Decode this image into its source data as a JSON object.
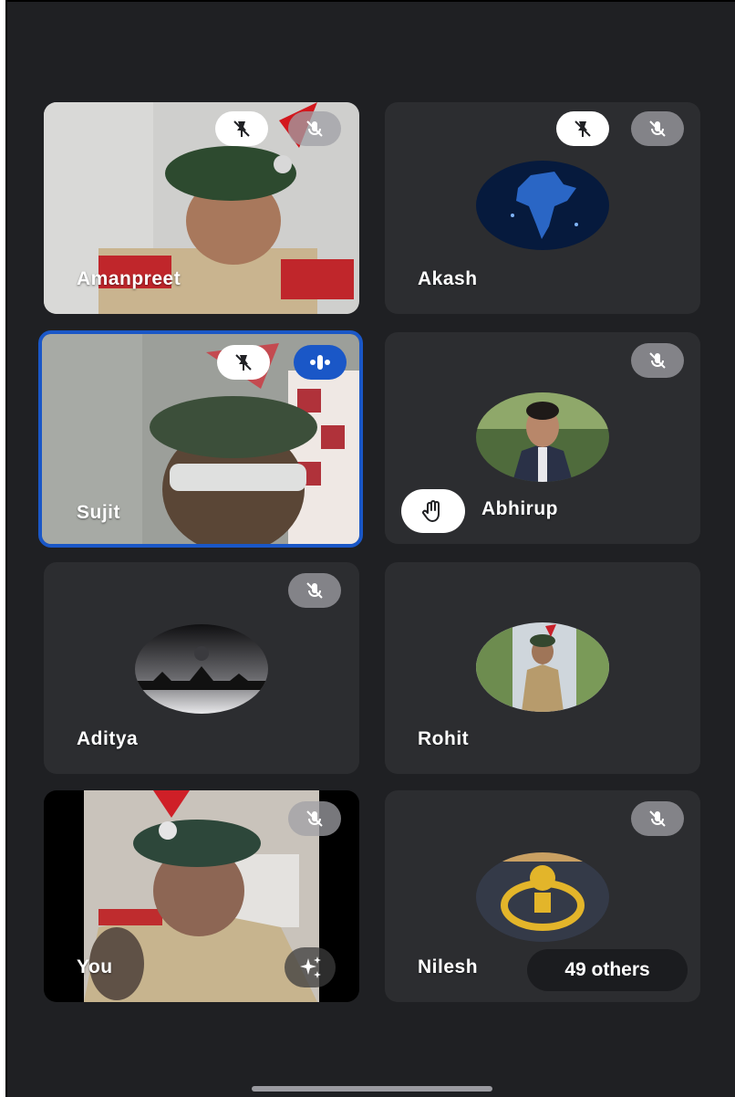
{
  "participants": [
    {
      "name": "Amanpreet"
    },
    {
      "name": "Akash"
    },
    {
      "name": "Sujit"
    },
    {
      "name": "Abhirup"
    },
    {
      "name": "Aditya"
    },
    {
      "name": "Rohit"
    },
    {
      "name": "You"
    },
    {
      "name": "Nilesh"
    }
  ],
  "others_label": "49 others",
  "icons": {
    "pin": "pin-off-icon",
    "mic_off": "mic-off-icon",
    "speaking": "audio-level-icon",
    "hand": "raised-hand-icon",
    "effects": "sparkle-effects-icon"
  },
  "colors": {
    "background": "#1f2023",
    "tile": "#2c2d30",
    "active_border": "#1a57c7"
  }
}
